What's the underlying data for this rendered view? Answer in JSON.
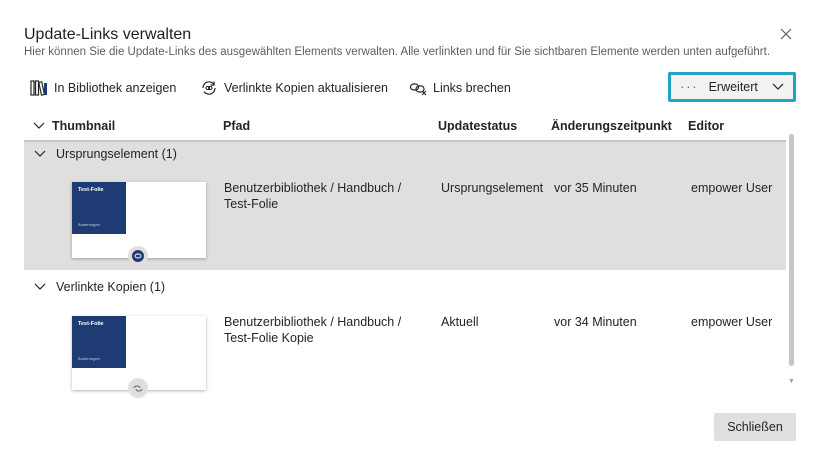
{
  "dialog": {
    "title": "Update-Links verwalten",
    "subtitle": "Hier können Sie die Update-Links des ausgewählten Elements verwalten. Alle verlinkten und für Sie sichtbaren Elemente werden unten aufgeführt."
  },
  "toolbar": {
    "show_in_library": "In Bibliothek anzeigen",
    "update_linked_copies": "Verlinkte Kopien aktualisieren",
    "break_links": "Links brechen",
    "advanced": "Erweitert",
    "advanced_dots": "···"
  },
  "table": {
    "columns": [
      "Thumbnail",
      "Pfad",
      "Updatestatus",
      "Änderungszeitpunkt",
      "Editor"
    ],
    "groups": [
      {
        "label": "Ursprungselement (1)",
        "rows": [
          {
            "thumb_title": "Test-Folie",
            "thumb_sub": "Änderungen",
            "path": "Benutzerbibliothek / Handbuch / Test-Folie",
            "status": "Ursprungselement",
            "changed": "vor 35 Minuten",
            "editor": "empower User"
          }
        ]
      },
      {
        "label": "Verlinkte Kopien (1)",
        "rows": [
          {
            "thumb_title": "Test-Folie",
            "thumb_sub": "Änderungen",
            "path": "Benutzerbibliothek / Handbuch / Test-Folie Kopie",
            "status": "Aktuell",
            "changed": "vor 34 Minuten",
            "editor": "empower User"
          }
        ]
      }
    ]
  },
  "footer": {
    "close_label": "Schließen"
  },
  "colors": {
    "accent_highlight": "#21a3c4",
    "selected_row": "#e1dfdd",
    "slide_blue": "#1f3b73"
  }
}
